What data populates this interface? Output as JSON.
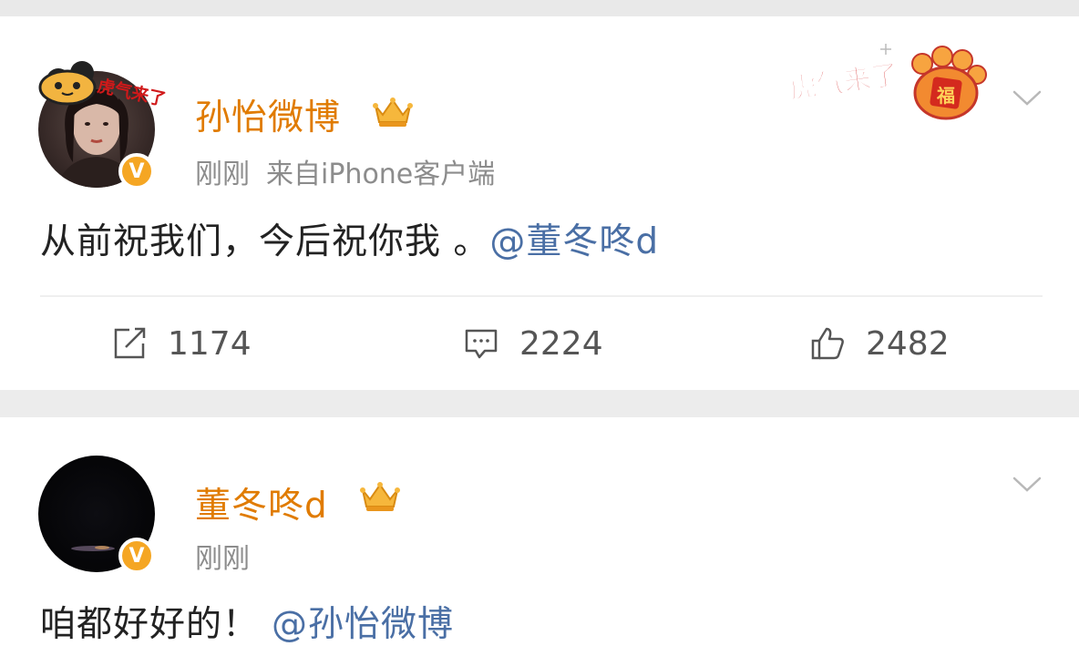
{
  "posts": [
    {
      "username": "孙怡微博",
      "time": "刚刚",
      "source": "来自iPhone客户端",
      "avatar_badge": "V",
      "avatar_decoration_text": "虎气来了",
      "sticker_text": "虎气来了",
      "sticker_badge": "福",
      "content_text": "从前祝我们，今后祝你我 。",
      "mention": "@董冬咚d",
      "actions": {
        "repost_count": "1174",
        "comment_count": "2224",
        "like_count": "2482"
      }
    },
    {
      "username": "董冬咚d",
      "time": "刚刚",
      "avatar_badge": "V",
      "content_text": "咱都好好的！",
      "mention": "@孙怡微博"
    }
  ],
  "colors": {
    "username": "#e07b00",
    "mention": "#4a6fa5",
    "meta": "#8c8c8c",
    "verified": "#f5a623",
    "page_bg": "#ececec"
  }
}
